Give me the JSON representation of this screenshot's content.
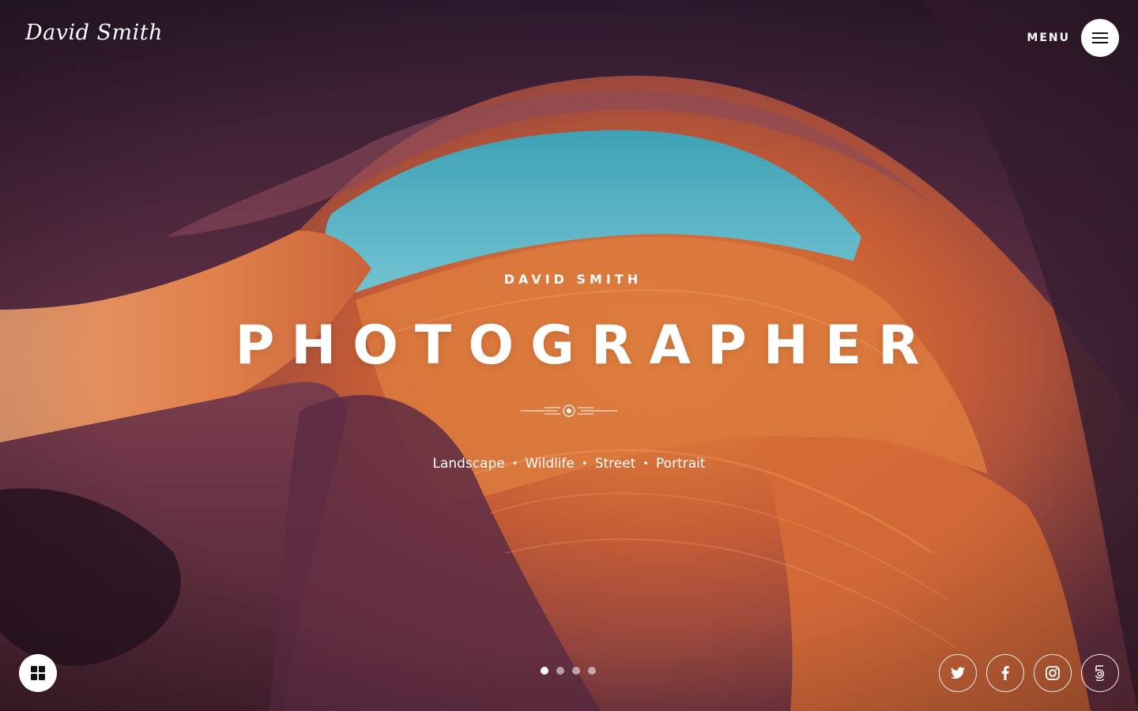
{
  "brand": {
    "logo_text": "David Smith"
  },
  "header": {
    "menu_label": "MENU",
    "menu_icon": "hamburger-icon"
  },
  "hero": {
    "subtitle": "DAVID SMITH",
    "headline": "PHOTOGRAPHER",
    "divider_icon": "ornament-divider-icon",
    "categories": [
      "Landscape",
      "Wildlife",
      "Street",
      "Portrait"
    ],
    "category_separator": "•"
  },
  "footer": {
    "grid_icon": "grid-icon",
    "slider": {
      "count": 4,
      "active_index": 0
    },
    "social": [
      {
        "name": "twitter",
        "icon": "twitter-icon"
      },
      {
        "name": "facebook",
        "icon": "facebook-icon"
      },
      {
        "name": "instagram",
        "icon": "instagram-icon"
      },
      {
        "name": "500px",
        "icon": "500px-icon"
      }
    ]
  },
  "colors": {
    "sky": "#5ab0c4",
    "rock_orange": "#d9733a",
    "rock_purple": "#5e2f4e",
    "text": "#ffffff"
  }
}
